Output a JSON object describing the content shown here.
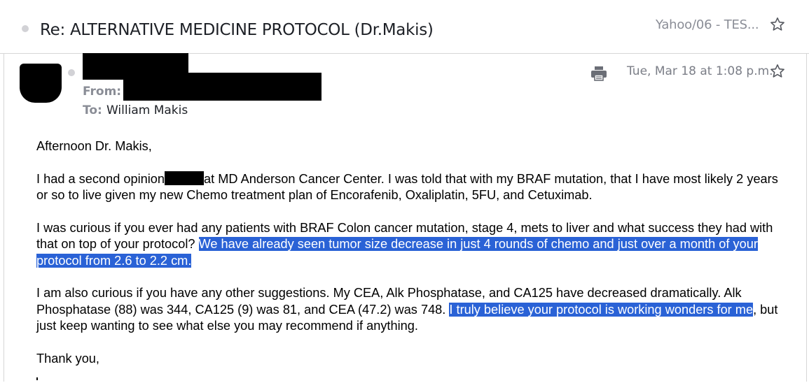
{
  "subject_bar": {
    "subject": "Re: ALTERNATIVE MEDICINE PROTOCOL (Dr.Makis)",
    "folder": "Yahoo/06 - TES..."
  },
  "message": {
    "from_label": "From:",
    "to_label": "To:",
    "to_value": "William Makis",
    "date": "Tue, Mar 18 at 1:08 p.m.",
    "greeting": "Afternoon Dr. Makis,",
    "p1_a": "I had a second opinion",
    "p1_b": "at MD Anderson Cancer Center. I was told that with my BRAF mutation, that I have most likely 2 years or so to live given my new Chemo treatment plan of Encorafenib, Oxaliplatin, 5FU, and Cetuximab.",
    "p2_a": "I was curious if you ever had any patients with BRAF Colon cancer mutation, stage 4, mets to liver and what success they had with that on top of your protocol? ",
    "p2_hl": "We have already seen tumor size decrease in just 4 rounds of chemo and just over a month of your protocol from 2.6 to 2.2 cm.",
    "p3_a": "I am also curious if you have any other suggestions. My CEA, Alk Phosphatase, and CA125 have decreased dramatically. Alk Phosphatase (88) was 344, CA125 (9) was 81, and CEA (47.2) was 748. ",
    "p3_hl": "I truly believe your protocol is working wonders for me",
    "p3_b": ", but just keep wanting to see what else you may recommend if anything.",
    "closing": "Thank you,"
  },
  "colors": {
    "highlight": "#2a62d6",
    "muted_text": "#8a8d96"
  },
  "icons": [
    "star-icon",
    "printer-icon",
    "unread-dot-icon"
  ]
}
